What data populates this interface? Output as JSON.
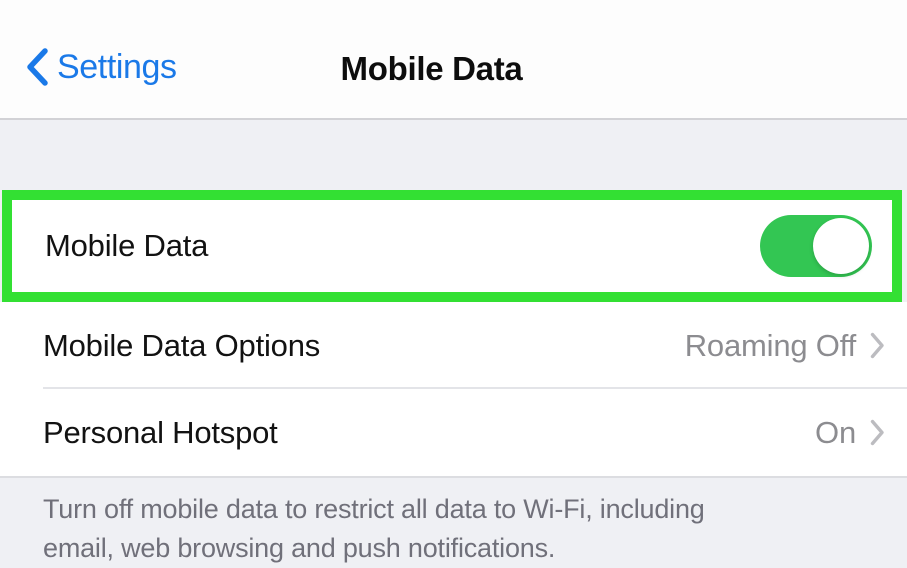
{
  "navbar": {
    "back_label": "Settings",
    "back_icon": "chevron-left-icon",
    "title": "Mobile Data"
  },
  "highlighted_row": {
    "label": "Mobile Data",
    "toggle_state": "on",
    "toggle_color": "#33c653",
    "highlight_color": "#33e033"
  },
  "rows": [
    {
      "label": "Mobile Data Options",
      "value": "Roaming Off",
      "accessory": "chevron-right-icon"
    },
    {
      "label": "Personal Hotspot",
      "value": "On",
      "accessory": "chevron-right-icon"
    }
  ],
  "footer": {
    "line1": "Turn off mobile data to restrict all data to Wi-Fi, including",
    "line2": "email, web browsing and push notifications."
  }
}
